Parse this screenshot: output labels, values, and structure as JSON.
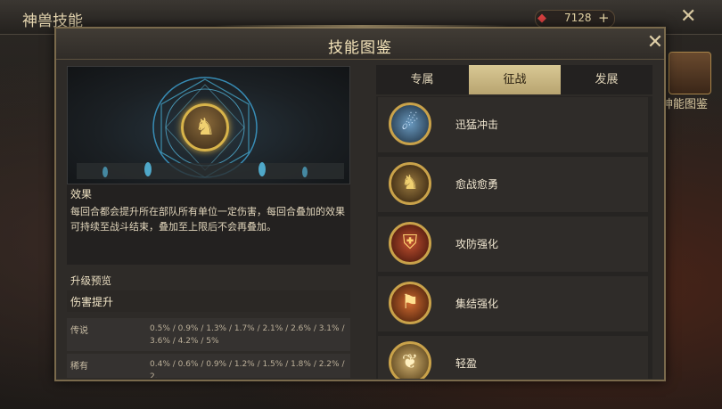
{
  "background": {
    "title": "神兽技能",
    "resource_count": "7128",
    "side_label": "神能图鉴"
  },
  "modal": {
    "title": "技能图鉴",
    "close_icon": "close-x-icon"
  },
  "skill_detail": {
    "effect_title": "效果",
    "effect_text": "每回合都会提升所在部队所有单位一定伤害，每回合叠加的效果可持续至战斗结束，叠加至上限后不会再叠加。",
    "upgrade_title": "升级预览",
    "upgrade_subtitle": "伤害提升",
    "upgrade_rows": [
      {
        "label": "传说",
        "values": "0.5% / 0.9% / 1.3% / 1.7% / 2.1% / 2.6% / 3.1% / 3.6% / 4.2% / 5%"
      },
      {
        "label": "稀有",
        "values": "0.4% / 0.6% / 0.9% / 1.2% / 1.5% / 1.8% / 2.2% / 2."
      }
    ]
  },
  "tabs": [
    {
      "label": "专属",
      "active": false
    },
    {
      "label": "征战",
      "active": true
    },
    {
      "label": "发展",
      "active": false
    }
  ],
  "skills": [
    {
      "name": "迅猛冲击",
      "icon": "storm-strike-icon",
      "color": "#5a8ab0"
    },
    {
      "name": "愈战愈勇",
      "icon": "warrior-icon",
      "color": "#8a6a30"
    },
    {
      "name": "攻防强化",
      "icon": "shield-sword-icon",
      "color": "#a03020"
    },
    {
      "name": "集结强化",
      "icon": "banner-icon",
      "color": "#b04020"
    },
    {
      "name": "轻盈",
      "icon": "wing-icon",
      "color": "#c0a060"
    }
  ]
}
